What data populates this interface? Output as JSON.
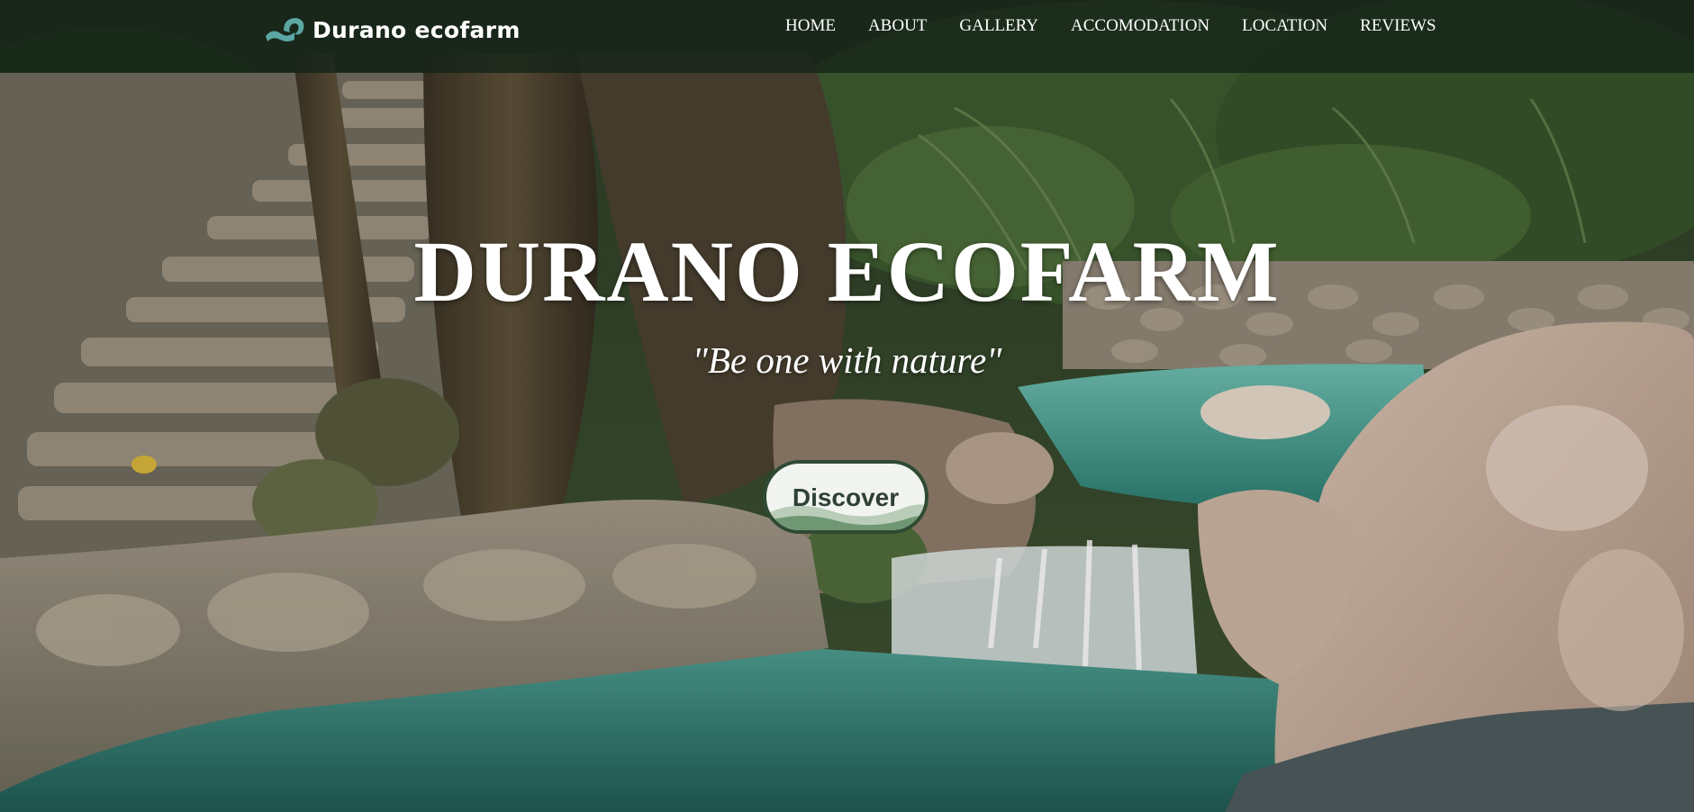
{
  "brand": {
    "name": "Durano ecofarm",
    "logo_icon": "wave-icon"
  },
  "nav": {
    "items": [
      {
        "label": "HOME"
      },
      {
        "label": "ABOUT"
      },
      {
        "label": "GALLERY"
      },
      {
        "label": "ACCOMODATION"
      },
      {
        "label": "LOCATION"
      },
      {
        "label": "REVIEWS"
      }
    ]
  },
  "hero": {
    "title": "DURANO ECOFARM",
    "tagline": "\"Be one with nature\"",
    "cta_label": "Discover"
  },
  "colors": {
    "accent": "#2f4a33",
    "logo": "#5ba7a3",
    "water": "#3f9a8c",
    "text": "#ffffff"
  }
}
